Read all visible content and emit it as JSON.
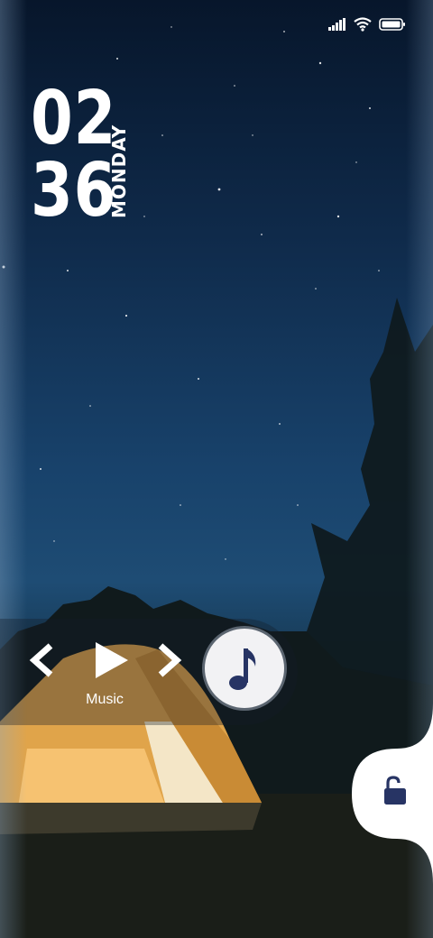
{
  "lockscreen": {
    "hour": "02",
    "minute": "36",
    "day": "MONDAY"
  },
  "status_bar": {
    "icons": [
      "signal-icon",
      "wifi-icon",
      "battery-icon"
    ]
  },
  "music": {
    "label": "Music",
    "controls": [
      "previous-track-icon",
      "play-icon",
      "next-track-icon"
    ],
    "disc_icon": "music-note-icon",
    "note_color": "#273464"
  },
  "unlock": {
    "icon": "unlock-icon",
    "color": "#273464"
  }
}
